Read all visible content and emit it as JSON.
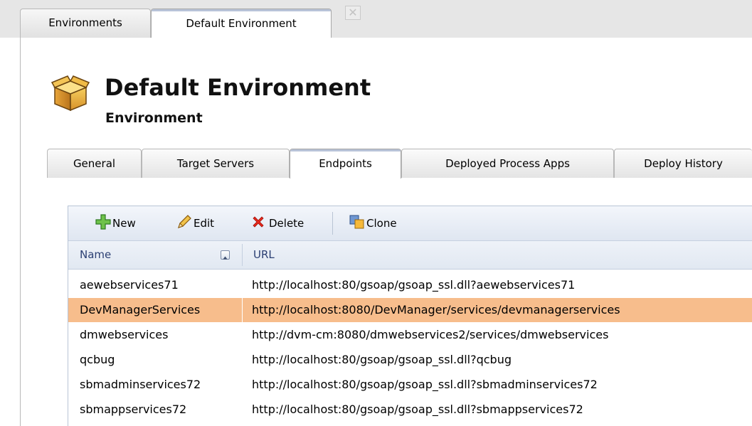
{
  "doc_tabs": [
    {
      "label": "Environments",
      "active": false
    },
    {
      "label": "Default Environment",
      "active": true
    }
  ],
  "doc_close_label": "✕",
  "header": {
    "title": "Default Environment",
    "subtitle": "Environment",
    "icon": "box-icon"
  },
  "tabs": [
    {
      "label": "General",
      "active": false
    },
    {
      "label": "Target Servers",
      "active": false
    },
    {
      "label": "Endpoints",
      "active": true
    },
    {
      "label": "Deployed Process Apps",
      "active": false
    },
    {
      "label": "Deploy History",
      "active": false
    }
  ],
  "toolbar": {
    "new_label": "New",
    "edit_label": "Edit",
    "delete_label": "Delete",
    "clone_label": "Clone"
  },
  "table": {
    "columns": [
      "Name",
      "URL"
    ],
    "sorted_column": "Name",
    "rows": [
      {
        "name": "aewebservices71",
        "url": "http://localhost:80/gsoap/gsoap_ssl.dll?aewebservices71",
        "selected": false
      },
      {
        "name": "DevManagerServices",
        "url": "http://localhost:8080/DevManager/services/devmanagerservices",
        "selected": true
      },
      {
        "name": "dmwebservices",
        "url": "http://dvm-cm:8080/dmwebservices2/services/dmwebservices",
        "selected": false
      },
      {
        "name": "qcbug",
        "url": "http://localhost:80/gsoap/gsoap_ssl.dll?qcbug",
        "selected": false
      },
      {
        "name": "sbmadminservices72",
        "url": "http://localhost:80/gsoap/gsoap_ssl.dll?sbmadminservices72",
        "selected": false
      },
      {
        "name": "sbmappservices72",
        "url": "http://localhost:80/gsoap/gsoap_ssl.dll?sbmappservices72",
        "selected": false
      }
    ]
  },
  "colors": {
    "selected_row": "#f7bd8c",
    "header_text": "#2b3f73",
    "tab_accent": "#b8c3d8"
  }
}
